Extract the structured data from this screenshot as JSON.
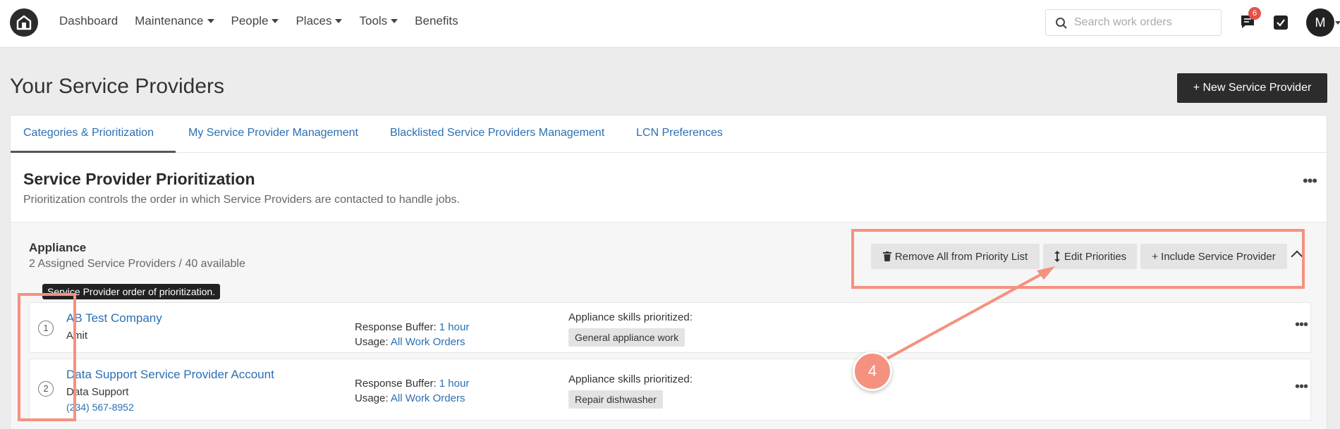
{
  "nav": {
    "items": [
      {
        "label": "Dashboard",
        "dropdown": false
      },
      {
        "label": "Maintenance",
        "dropdown": true
      },
      {
        "label": "People",
        "dropdown": true
      },
      {
        "label": "Places",
        "dropdown": true
      },
      {
        "label": "Tools",
        "dropdown": true
      },
      {
        "label": "Benefits",
        "dropdown": false
      }
    ],
    "search_placeholder": "Search work orders",
    "chat_badge": "6",
    "avatar_initial": "M"
  },
  "page": {
    "title": "Your Service Providers",
    "new_button": "+ New Service Provider"
  },
  "tabs": [
    {
      "label": "Categories & Prioritization",
      "active": true
    },
    {
      "label": "My Service Provider Management",
      "active": false
    },
    {
      "label": "Blacklisted Service Providers Management",
      "active": false
    },
    {
      "label": "LCN Preferences",
      "active": false
    }
  ],
  "section": {
    "title": "Service Provider Prioritization",
    "description": "Prioritization controls the order in which Service Providers are contacted to handle jobs.",
    "menu": "•••"
  },
  "group": {
    "name": "Appliance",
    "subtitle": "2 Assigned Service Providers / 40 available",
    "remove_all": "Remove All from Priority List",
    "edit_priorities": "Edit Priorities",
    "include": "+ Include Service Provider"
  },
  "tooltip": "Service Provider order of prioritization.",
  "providers": [
    {
      "rank": "1",
      "name": "AB Test Company",
      "contact": "Amit",
      "phone": "",
      "response_label": "Response Buffer: ",
      "response_value": "1 hour",
      "usage_label": "Usage: ",
      "usage_value": "All Work Orders",
      "skills_label": "Appliance skills prioritized:",
      "skill": "General appliance work",
      "menu": "•••"
    },
    {
      "rank": "2",
      "name": "Data Support Service Provider Account",
      "contact": "Data Support",
      "phone": "(234) 567-8952",
      "response_label": "Response Buffer: ",
      "response_value": "1 hour",
      "usage_label": "Usage: ",
      "usage_value": "All Work Orders",
      "skills_label": "Appliance skills prioritized:",
      "skill": "Repair dishwasher",
      "menu": "•••"
    }
  ],
  "annotation": {
    "step": "4",
    "color": "#f5917f"
  }
}
